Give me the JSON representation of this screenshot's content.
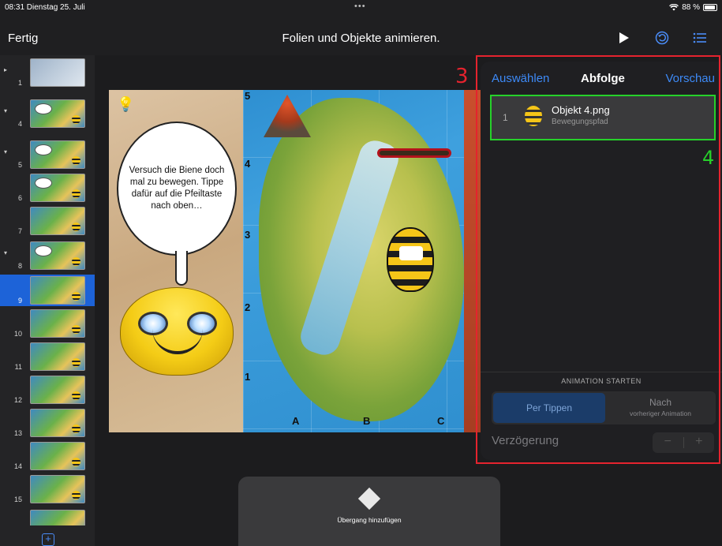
{
  "status_bar": {
    "time": "08:31  Dienstag 25. Juli",
    "dots": "•••",
    "battery": "88 %"
  },
  "nav": {
    "done_label": "Fertig",
    "title": "Folien und Objekte animieren.",
    "icons": [
      "play-icon",
      "rewind-icon",
      "list-icon"
    ]
  },
  "sidebar": {
    "slides": [
      {
        "number": "1",
        "disclosure": "▸"
      },
      {
        "number": "4",
        "disclosure": "▾"
      },
      {
        "number": "5",
        "disclosure": "▾"
      },
      {
        "number": "6",
        "disclosure": ""
      },
      {
        "number": "7",
        "disclosure": ""
      },
      {
        "number": "8",
        "disclosure": "▾"
      },
      {
        "number": "9",
        "disclosure": "",
        "selected": true
      },
      {
        "number": "10",
        "disclosure": ""
      },
      {
        "number": "11",
        "disclosure": ""
      },
      {
        "number": "12",
        "disclosure": ""
      },
      {
        "number": "13",
        "disclosure": ""
      },
      {
        "number": "14",
        "disclosure": ""
      },
      {
        "number": "15",
        "disclosure": ""
      }
    ],
    "add_label": "+"
  },
  "slide": {
    "speech_text": "Versuch die Biene doch mal zu bewegen. Tippe dafür auf die Pfeiltaste nach oben…",
    "grid_rows": [
      "5",
      "4",
      "3",
      "2",
      "1"
    ],
    "grid_cols": [
      "A",
      "B",
      "C"
    ]
  },
  "transition": {
    "label": "Übergang hinzufügen"
  },
  "panel": {
    "select_label": "Auswählen",
    "title": "Abfolge",
    "preview_label": "Vorschau",
    "items": [
      {
        "index": "1",
        "name": "Objekt 4.png",
        "subtitle": "Bewegungspfad"
      }
    ],
    "start_heading": "ANIMATION STARTEN",
    "option_tap": "Per Tippen",
    "option_after": "Nach",
    "option_after_sub": "vorheriger Animation",
    "delay_label": "Verzögerung",
    "stepper_minus": "−",
    "stepper_plus": "+"
  },
  "annotations": {
    "label_3": "3",
    "label_4": "4",
    "red": "#e5232e",
    "green": "#26d12a"
  }
}
